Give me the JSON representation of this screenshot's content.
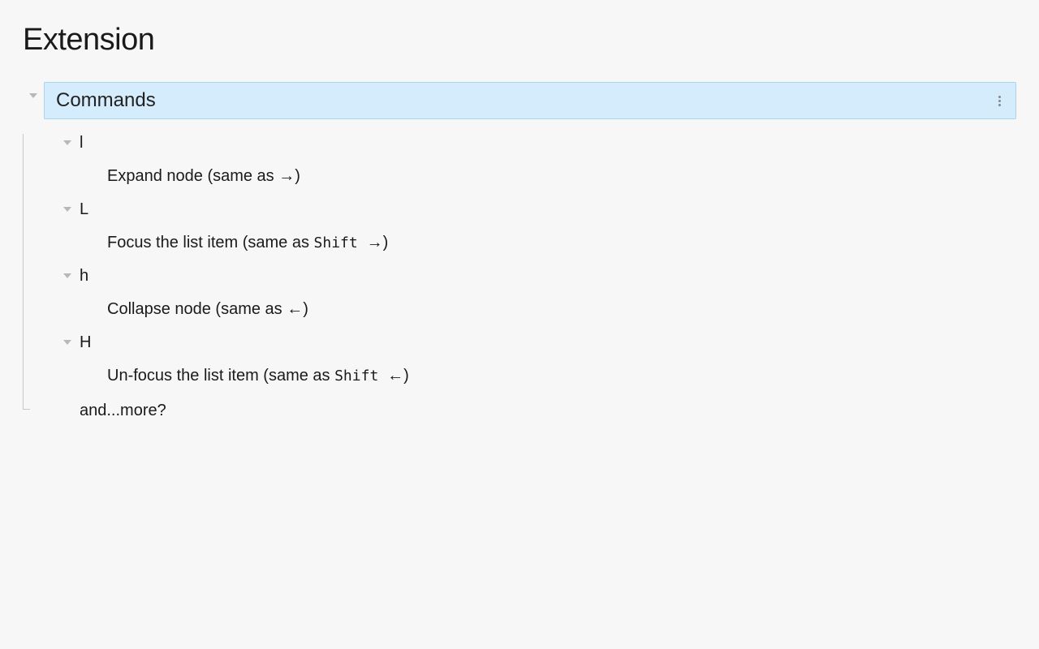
{
  "title": "Extension",
  "section": {
    "title": "Commands"
  },
  "commands": [
    {
      "key": "l",
      "desc_prefix": "Expand node (same as ",
      "desc_mono": "",
      "desc_arrow": "→",
      "desc_suffix": ")"
    },
    {
      "key": "L",
      "desc_prefix": "Focus the list item (same as ",
      "desc_mono": "Shift ",
      "desc_arrow": "→",
      "desc_suffix": ")"
    },
    {
      "key": "h",
      "desc_prefix": "Collapse node (same as ",
      "desc_mono": "",
      "desc_arrow": "←",
      "desc_suffix": ")"
    },
    {
      "key": "H",
      "desc_prefix": "Un-focus the list item (same as ",
      "desc_mono": "Shift ",
      "desc_arrow": "←",
      "desc_suffix": ")"
    }
  ],
  "more_text": "and...more?"
}
